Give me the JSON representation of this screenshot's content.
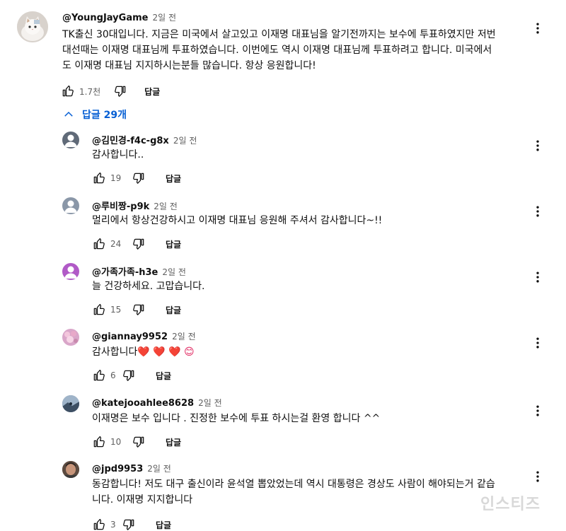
{
  "main_comment": {
    "author": "@YoungJayGame",
    "time": "2일 전",
    "text_line1": "TK출신 30대입니다. 지금은 미국에서 살고있고 이재명 대표님을 알기전까지는 보수에 투표하였지만 저번",
    "text_line2": "대선때는 이재명 대표님께 투표하였습니다. 이번에도 역시 이재명 대표님께 투표하려고 합니다. 미국에서",
    "text_line3": "도 이재명 대표님 지지하시는분들 많습니다. 항상 응원합니다!",
    "likes": "1.7천",
    "reply_label": "답글",
    "avatar_icon": "cat-avatar-icon"
  },
  "replies_toggle": {
    "label": "답글 29개",
    "icon": "chevron-up-icon"
  },
  "replies": [
    {
      "author": "@김민경-f4c-g8x",
      "time": "2일 전",
      "text": "감사합니다..",
      "likes": "19",
      "reply_label": "답글",
      "avatar_color": "#606a78"
    },
    {
      "author": "@루비짱-p9k",
      "time": "2일 전",
      "text": "멀리에서 항상건강하시고 이재명 대표님 응원해 주셔서 감사합니다~!!",
      "likes": "24",
      "reply_label": "답글",
      "avatar_color": "#8a97a8"
    },
    {
      "author": "@가족가족-h3e",
      "time": "2일 전",
      "text": "늘 건강하세요. 고맙습니다.",
      "likes": "15",
      "reply_label": "답글",
      "avatar_color": "#b15ac7"
    },
    {
      "author": "@giannay9952",
      "time": "2일 전",
      "text": "감사합니다",
      "emoji": "❤️ ❤️ ❤️ 😊",
      "likes": "6",
      "reply_label": "답글",
      "avatar_color": "#d9a6c9"
    },
    {
      "author": "@katejooahlee8628",
      "time": "2일 전",
      "text": "이재명은 보수 입니다 . 진정한 보수에 투표 하시는걸 환영 합니다 ^^",
      "likes": "10",
      "reply_label": "답글",
      "avatar_color": "#5a6f8a"
    },
    {
      "author": "@jpd9953",
      "time": "2일 전",
      "text_line1": "동감합니다! 저도 대구 출신이라 윤석열 뽑았었는데 역시 대통령은 경상도 사람이 해야되는거 같습",
      "text_line2": "니다. 이재명 지지합니다",
      "likes": "3",
      "reply_label": "답글",
      "avatar_color": "#7a5a48"
    }
  ],
  "watermark": "인스티즈",
  "colors": {
    "link_blue": "#065fd4",
    "text": "#0f0f0f",
    "secondary": "#606060"
  }
}
